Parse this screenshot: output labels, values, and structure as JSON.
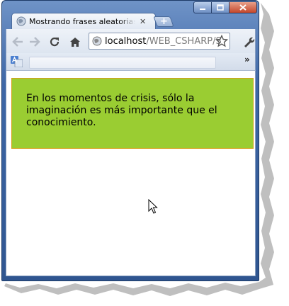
{
  "tab": {
    "title": "Mostrando frases aleatorias con",
    "close": "✕"
  },
  "newtab": {
    "label": "+"
  },
  "omnibox": {
    "host": "localhost",
    "path": "/WEB_CSHARP/S"
  },
  "bookmarks": {
    "more": "»"
  },
  "quote": {
    "text": "En los momentos de crisis, sólo la imaginación es más importante que el conocimiento."
  },
  "colors": {
    "quote_background": "#9acd32",
    "quote_border": "#d4a017",
    "frame_blue": "#3e67a6"
  },
  "icons": [
    "minimize-icon",
    "maximize-icon",
    "close-icon",
    "globe-icon",
    "back-arrow-icon",
    "forward-arrow-icon",
    "reload-icon",
    "home-icon",
    "star-icon",
    "wrench-icon",
    "translate-icon",
    "mouse-cursor-icon"
  ]
}
